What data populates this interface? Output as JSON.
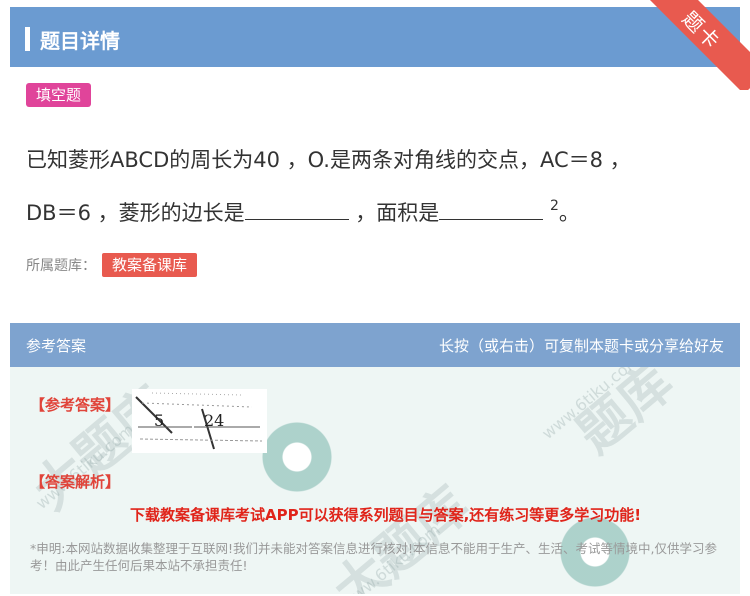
{
  "header": {
    "title": "题目详情",
    "ribbon": "题卡"
  },
  "question": {
    "type_tag": "填空题",
    "line1": "已知菱形ABCD的周长为40 ，O.是两条对角线的交点，AC＝8 ，",
    "line2_a": "DB＝6 ，菱形的边长是",
    "line2_b": " ，面积是",
    "sup": "2",
    "line2_end": "。"
  },
  "bank": {
    "label": "所属题库：",
    "tag": "教案备课库"
  },
  "answer_section": {
    "left": "参考答案",
    "right": "长按（或右击）可复制本题卡或分享给好友",
    "ref_label": "【参考答案】",
    "answer_values": [
      "5",
      "24"
    ],
    "analysis_label": "【答案解析】",
    "promo": "下载教案备课库考试APP可以获得系列题目与答案,还有练习等更多学习功能!",
    "disclaimer": "*申明:本网站数据收集整理于互联网!我们并未能对答案信息进行核对!本信息不能用于生产、生活、考试等情境中,仅供学习参考！由此产生任何后果本站不承担责任!"
  },
  "colors": {
    "header_bg": "#6b9bd1",
    "ribbon": "#e85a4f",
    "type_tag": "#e0449a",
    "bank_tag": "#e85a4f",
    "answer_header": "#7ea3cf",
    "answer_panel": "#eef6f4",
    "promo": "#e0241a"
  }
}
